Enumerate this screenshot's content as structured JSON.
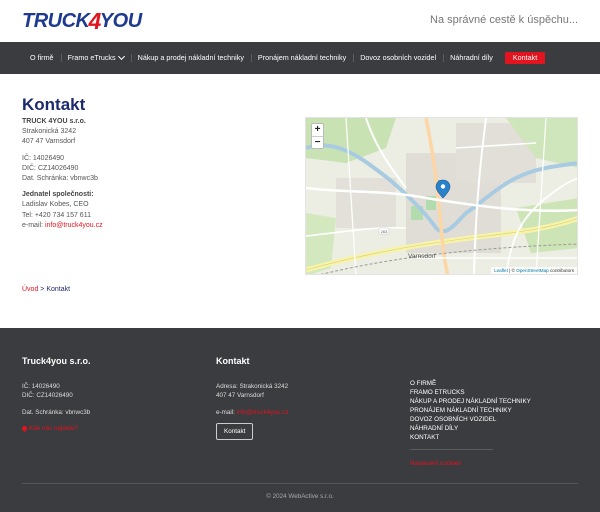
{
  "header": {
    "logo": {
      "part1": "TRUCK",
      "part2": "4",
      "part3": "YOU"
    },
    "tagline": "Na správné cestě k úspěchu..."
  },
  "nav": {
    "items": [
      {
        "label": "O firmě"
      },
      {
        "label": "Framo eTrucks"
      },
      {
        "label": "Nákup a prodej nákladní techniky"
      },
      {
        "label": "Pronájem nákladní techniky"
      },
      {
        "label": "Dovoz osobních vozidel"
      },
      {
        "label": "Náhradní díly"
      },
      {
        "label": "Kontakt"
      }
    ],
    "dropdown_icon": "chevron-down-icon"
  },
  "main": {
    "title": "Kontakt",
    "company": "TRUCK 4YOU s.r.o.",
    "street": "Strakonická 3242",
    "city": "407 47 Varnsdorf",
    "ic": "IČ:  14026490",
    "dic": "DIČ: CZ14026490",
    "datbox": "Dat. Schránka: vbnwc3b",
    "rep_heading": "Jednatel společnosti:",
    "rep_name": "Ladislav Kobes, CEO",
    "phone": "Tel: +420 734 157 611",
    "email_label": "e-mail: ",
    "email": "info@truck4you.cz"
  },
  "map": {
    "zoom_in": "+",
    "zoom_out": "−",
    "city_label": "Varnsdorf",
    "road_label": "263",
    "attrib_leaflet": "Leaflet",
    "attrib_sep": " | © ",
    "attrib_osm": "OpenStreetMap",
    "attrib_tail": " contributors"
  },
  "breadcrumb": {
    "home": "Úvod",
    "sep": " > ",
    "current": "Kontakt"
  },
  "footer": {
    "col1": {
      "title": "Truck4you s.r.o.",
      "ic": "IČ: 14026490",
      "dic": "DIČ: CZ14026490",
      "datbox": "Dat. Schránka: vbnwc3b",
      "find_us": "Kde nás najdete?"
    },
    "col2": {
      "title": "Kontakt",
      "address": "Adresa: Strakonická 3242",
      "city": "407 47 Varnsdorf",
      "email_label": "e-mail: ",
      "email": "info@truck4you.cz",
      "button": "Kontakt"
    },
    "links": [
      "O FIRMĚ",
      "FRAMO ETRUCKS",
      "NÁKUP A PRODEJ NÁKLADNÍ TECHNIKY",
      "PRONÁJEM NÁKLADNÍ TECHNIKY",
      "DOVOZ OSOBNÍCH VOZIDEL",
      "NÁHRADNÍ DÍLY",
      "KONTAKT"
    ],
    "cookies": "Nastavení cookies",
    "copyright": "© 2024  WebActive s.r.o."
  },
  "colors": {
    "brand_blue": "#1d3a8f",
    "brand_red": "#e1141f",
    "dark": "#3b3c3f"
  }
}
